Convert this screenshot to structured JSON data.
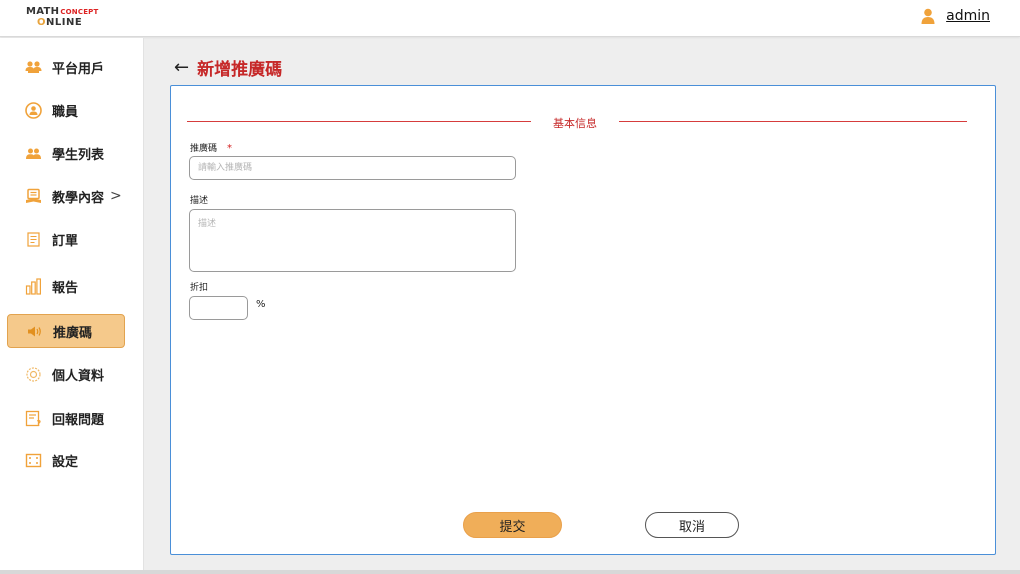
{
  "brand": {
    "math": "MATH",
    "concept": "CONCEPT",
    "online_o": "O",
    "online_rest": "NLINE"
  },
  "header": {
    "user_name": "admin",
    "user_icon": "user-icon"
  },
  "sidebar": {
    "items": [
      {
        "label": "平台用戶",
        "icon": "users-icon",
        "active": false
      },
      {
        "label": "職員",
        "icon": "staff-icon",
        "active": false
      },
      {
        "label": "學生列表",
        "icon": "students-icon",
        "active": false
      },
      {
        "label": "教學內容",
        "icon": "book-icon",
        "active": false,
        "chevron": ">"
      },
      {
        "label": "訂單",
        "icon": "order-icon",
        "active": false
      },
      {
        "label": "報告",
        "icon": "report-icon",
        "active": false
      },
      {
        "label": "推廣碼",
        "icon": "speaker-icon",
        "active": true
      },
      {
        "label": "個人資料",
        "icon": "profile-icon",
        "active": false
      },
      {
        "label": "回報問題",
        "icon": "feedback-icon",
        "active": false
      },
      {
        "label": "設定",
        "icon": "settings-icon",
        "active": false
      }
    ]
  },
  "page": {
    "back_arrow": "←",
    "title": "新增推廣碼"
  },
  "form": {
    "section_title": "基本信息",
    "promo_code": {
      "label": "推廣碼",
      "required_mark": "*",
      "placeholder": "請輸入推廣碼",
      "value": ""
    },
    "description": {
      "label": "描述",
      "placeholder": "描述",
      "value": ""
    },
    "discount": {
      "label": "折扣",
      "value": "",
      "unit": "%"
    },
    "submit_label": "提交",
    "cancel_label": "取消"
  },
  "colors": {
    "accent": "#f0ae59",
    "title_red": "#c62828",
    "panel_border": "#4a8fd8",
    "active_nav": "#f5c98b"
  }
}
